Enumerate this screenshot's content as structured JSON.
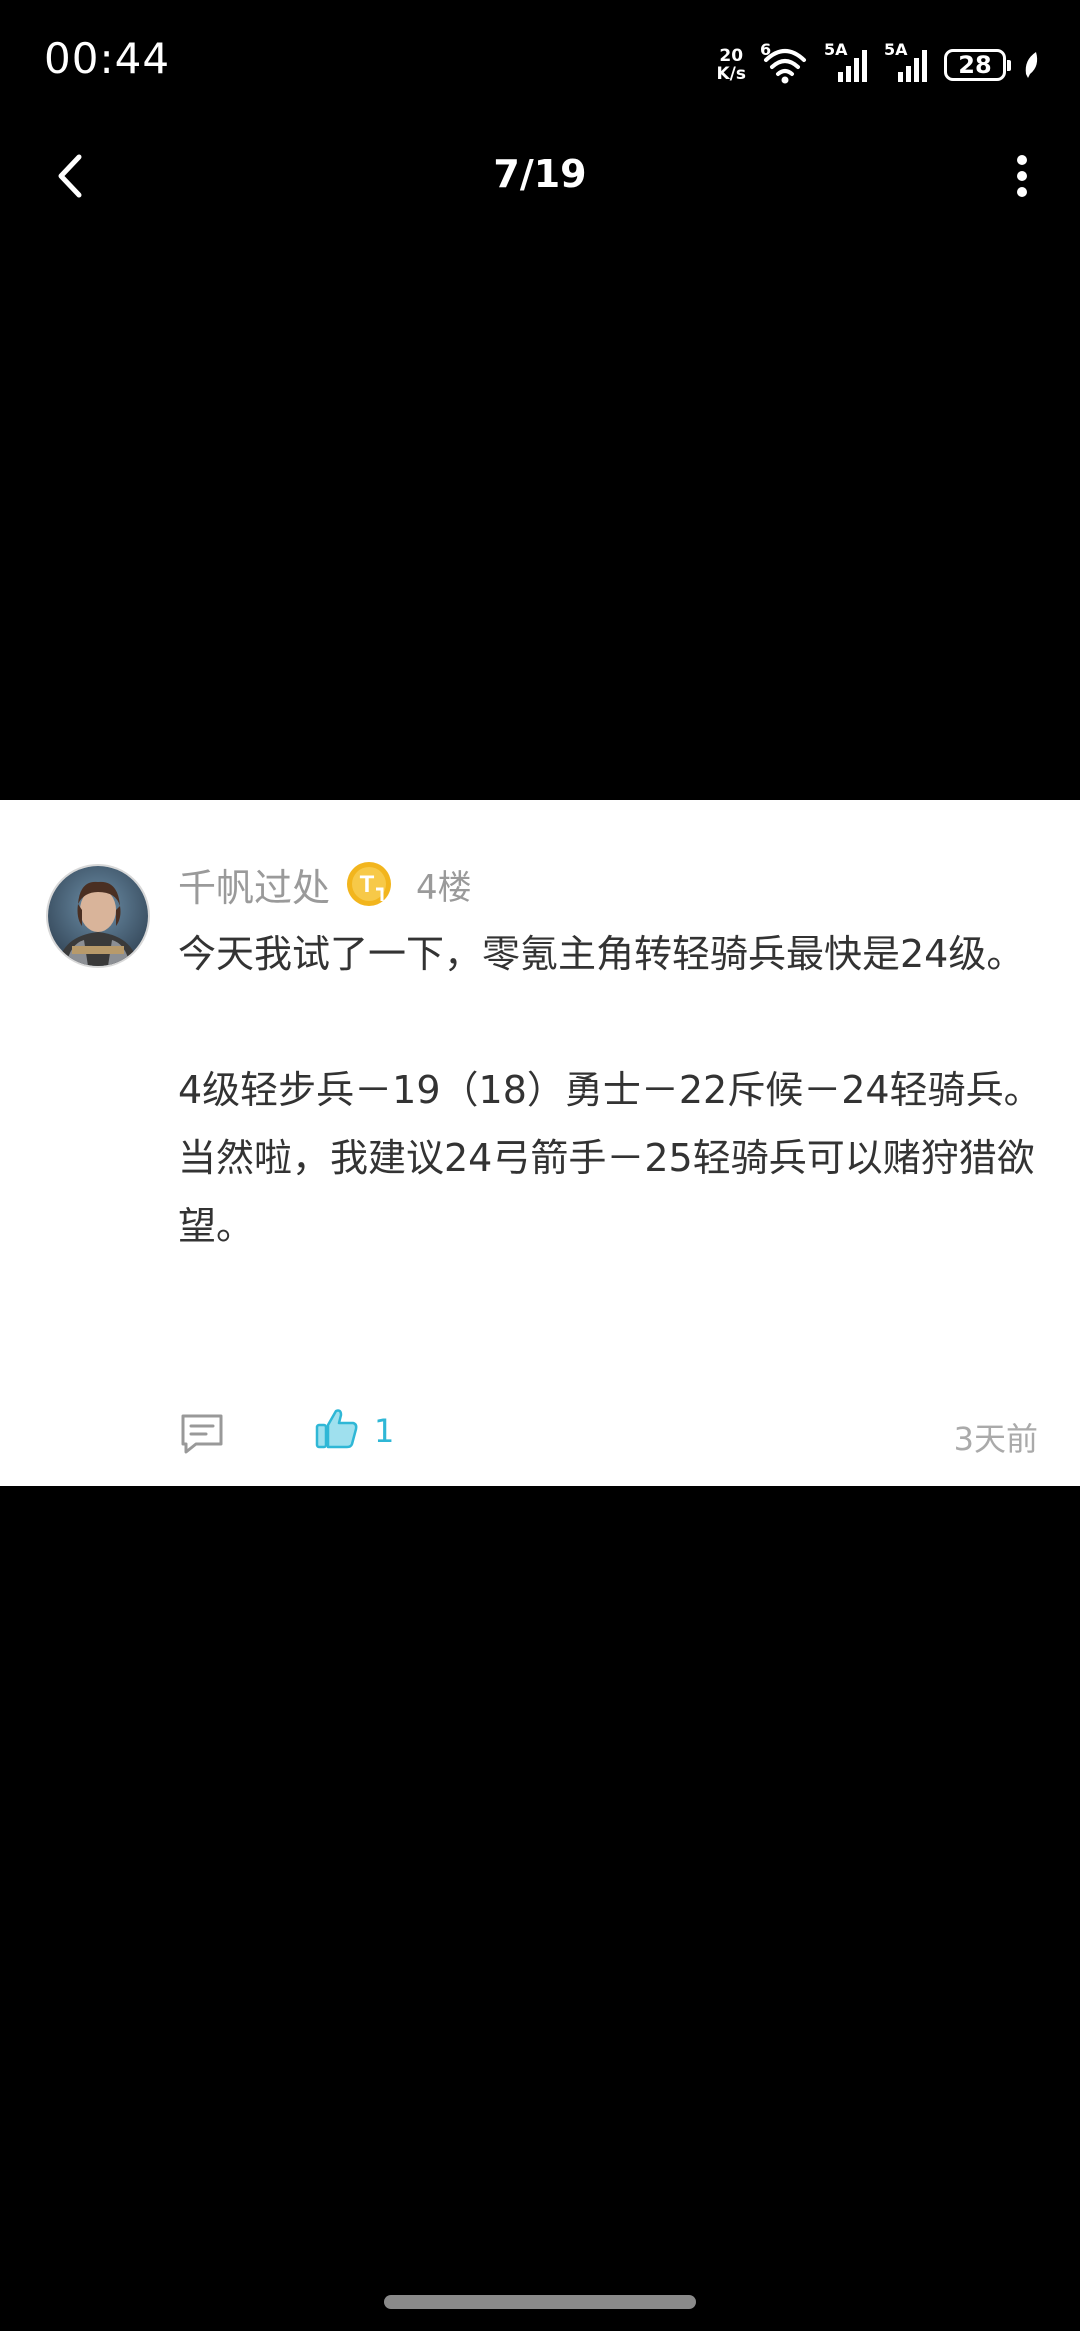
{
  "status_bar": {
    "time": "00:44",
    "net_speed_value": "20",
    "net_speed_unit": "K/s",
    "wifi_label": "6",
    "sim1_label": "5A",
    "sim2_label": "5A",
    "battery": "28",
    "icons": [
      "wifi-icon",
      "signal-icon",
      "signal-icon",
      "battery-icon",
      "leaf-icon"
    ]
  },
  "nav": {
    "page_counter": "7/19",
    "back_icon": "chevron-left-icon",
    "more_icon": "more-vertical-icon"
  },
  "comment": {
    "username": "千帆过处",
    "badge_letter": "T",
    "floor": "4楼",
    "paragraphs": [
      "今天我试了一下，零氪主角转轻骑兵最快是24级。",
      "",
      "4级轻步兵－19（18）勇士－22斥候－24轻骑兵。",
      "当然啦，我建议24弓箭手－25轻骑兵可以赌狩猎欲望。"
    ],
    "like_count": "1",
    "time_ago": "3天前"
  },
  "colors": {
    "accent": "#2fb7d6",
    "badge": "#f2b51d",
    "muted_text": "#9a9a9a",
    "body_text": "#333333",
    "background": "#000000",
    "card": "#ffffff"
  }
}
